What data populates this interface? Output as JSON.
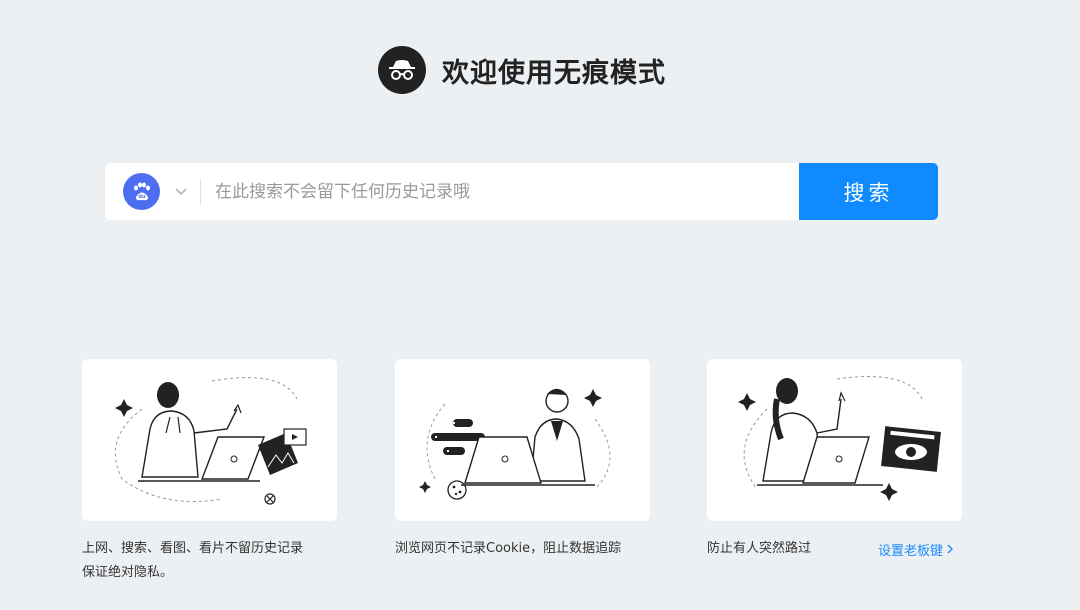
{
  "header": {
    "icon": "incognito-glasses-icon",
    "title": "欢迎使用无痕模式"
  },
  "search": {
    "engine_icon": "baidu-paw-icon",
    "engine_caret": "chevron-down-icon",
    "placeholder": "在此搜索不会留下任何历史记录哦",
    "value": "",
    "button_label": "搜索",
    "accent": "#0f8bff"
  },
  "cards": [
    {
      "illustration": "woman-laptop-illustration",
      "caption_line1": "上网、搜索、看图、看片不留历史记录",
      "caption_line2": "保证绝对隐私。"
    },
    {
      "illustration": "man-laptop-cookie-illustration",
      "caption_line1": "浏览网页不记录Cookie，阻止数据追踪"
    },
    {
      "illustration": "woman-laptop-eye-illustration",
      "caption_line1": "防止有人突然路过",
      "link_label": "设置老板键",
      "link_icon": "chevron-right-icon"
    }
  ]
}
